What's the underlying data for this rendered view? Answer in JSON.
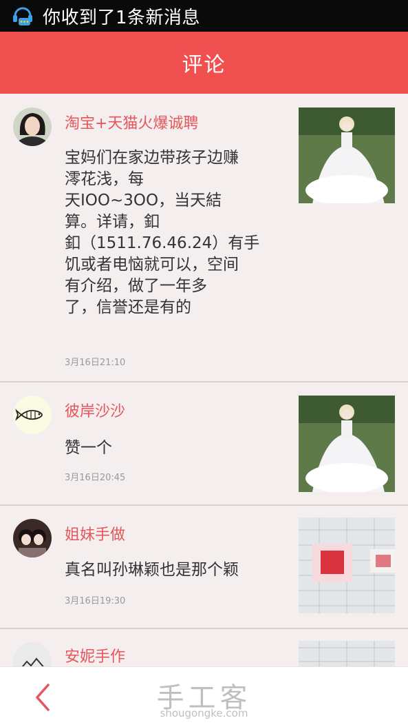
{
  "status_bar": {
    "notification": "你收到了1条新消息"
  },
  "header": {
    "title": "评论"
  },
  "comments": [
    {
      "name": "淘宝+天猫火爆诚聘",
      "text": "宝妈们在家边带孩子边赚\n澪花浅，每\n天IOO~3OO，当天結\n算。详请，釦\n釦（1511.76.46.24）有手\n饥或者电恼就可以，空间\n有介绍，做了一年多\n了，信誉还是有的",
      "time": "3月16日21:10"
    },
    {
      "name": "彼岸沙沙",
      "text": "赞一个",
      "time": "3月16日20:45"
    },
    {
      "name": "姐妹手做",
      "text": "真名叫孙琳颖也是那个颖",
      "time": "3月16日19:30"
    },
    {
      "name": "安妮手作"
    }
  ],
  "footer": {
    "brand_cn": "手工客",
    "brand_en": "shougongke.com"
  },
  "colors": {
    "accent": "#f0504f",
    "name": "#e5565a",
    "background": "#f5eeee"
  }
}
